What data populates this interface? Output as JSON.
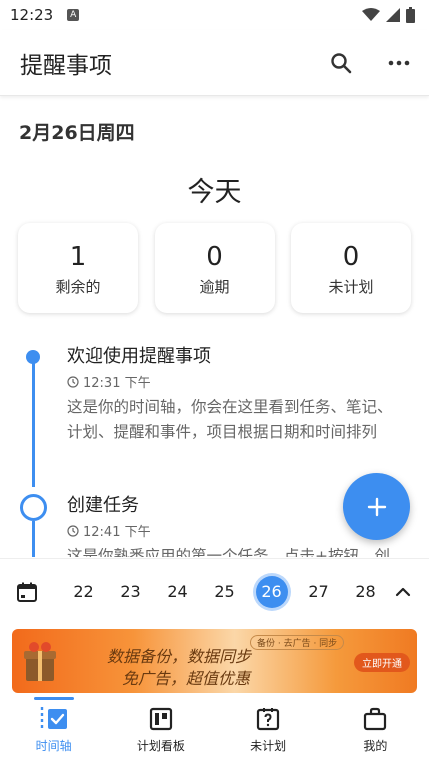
{
  "status_bar": {
    "time": "12:23",
    "notification_letter": "A"
  },
  "app_bar": {
    "title": "提醒事项",
    "icons": [
      "search-icon",
      "more-icon"
    ]
  },
  "date_heading": "2月26日周四",
  "today_title": "今天",
  "stats": [
    {
      "value": "1",
      "label": "剩余的"
    },
    {
      "value": "0",
      "label": "逾期"
    },
    {
      "value": "0",
      "label": "未计划"
    }
  ],
  "timeline": [
    {
      "title": "欢迎使用提醒事项",
      "time": "12:31 下午",
      "description": "这是你的时间轴，你会在这里看到任务、笔记、计划、提醒和事件，项目根据日期和时间排列",
      "marker": "dot"
    },
    {
      "title": "创建任务",
      "time": "12:41 下午",
      "description": "这是你熟悉应用的第一个任务，点击+按钮，创",
      "marker": "ring"
    }
  ],
  "week_bar": {
    "days": [
      "22",
      "23",
      "24",
      "25",
      "26",
      "27",
      "28"
    ],
    "selected_index": 4
  },
  "banner": {
    "line1": "数据备份，数据同步",
    "line2": "免广告，超值优惠",
    "tags": "备份 · 去广告 · 同步",
    "cta": "立即开通"
  },
  "bottom_nav": [
    {
      "label": "时间轴",
      "icon": "timeline-icon",
      "active": true
    },
    {
      "label": "计划看板",
      "icon": "kanban-icon",
      "active": false
    },
    {
      "label": "未计划",
      "icon": "unplanned-icon",
      "active": false
    },
    {
      "label": "我的",
      "icon": "profile-icon",
      "active": false
    }
  ],
  "colors": {
    "accent": "#3d8ef0"
  }
}
